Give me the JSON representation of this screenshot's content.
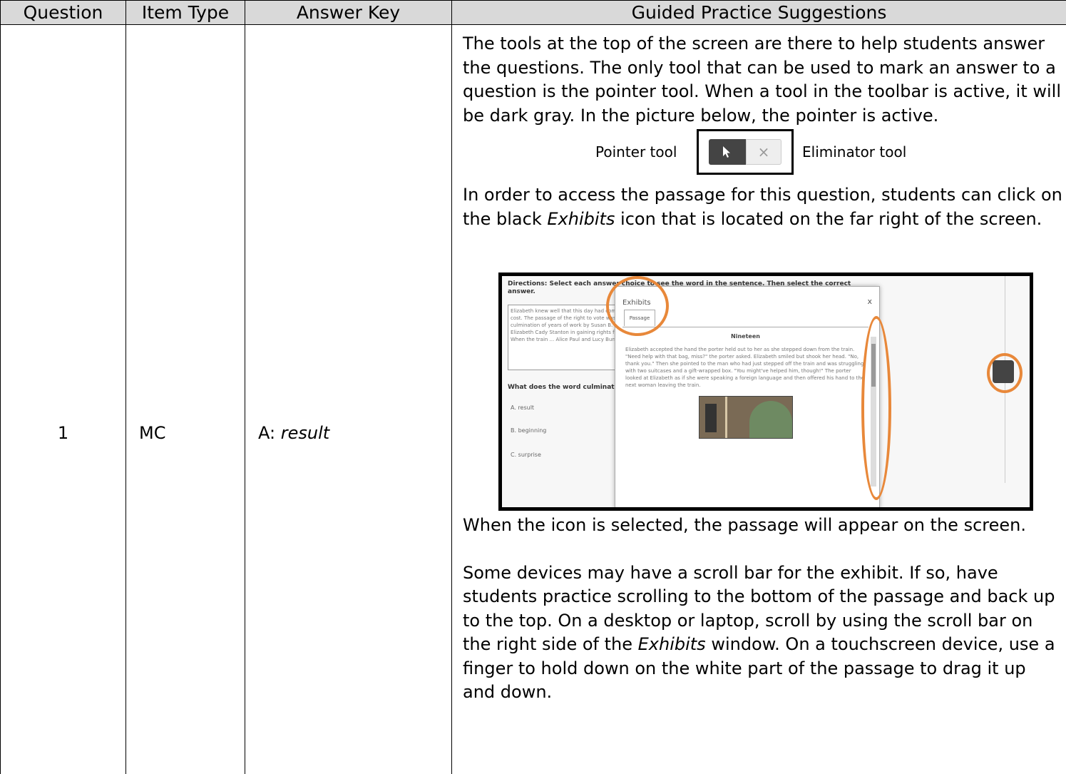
{
  "table": {
    "headers": {
      "question": "Question",
      "item_type": "Item Type",
      "answer_key": "Answer Key",
      "guided": "Guided Practice Suggestions"
    },
    "row": {
      "question": "1",
      "item_type": "MC",
      "answer_key_prefix": "A: ",
      "answer_key_value": "result"
    }
  },
  "guided": {
    "p1": "The tools at the top of the screen are there to help students answer the questions. The only tool that can be used to mark an answer to a question is the pointer tool. When a tool in the toolbar is active, it will be dark gray. In the picture below, the pointer is active.",
    "tool_figure": {
      "pointer_label": "Pointer tool",
      "eliminator_label": "Eliminator tool",
      "eliminator_glyph": "×"
    },
    "p2_a": "In order to access the passage for this question, students can click on the black ",
    "p2_em": "Exhibits",
    "p2_b": " icon that is located on the far right of the screen.",
    "screenshot": {
      "directions": "Directions: Select each answer choice to see the word in the sentence. Then select the correct answer.",
      "passage_text": "Elizabeth knew well that this day had come without a cost. The passage of the right to vote was the culmination of years of work by Susan B. Anthony and Elizabeth Cady Stanton in gaining rights for women. When the train ... Alice Paul and Lucy Burns, who pl...",
      "question": "What does the word culmination mean?",
      "options": [
        "A. result",
        "B. beginning",
        "C. surprise"
      ],
      "modal_title": "Exhibits",
      "modal_close": "x",
      "modal_tab": "Passage",
      "story_title": "Nineteen",
      "story_text": "Elizabeth accepted the hand the porter held out to her as she stepped down from the train. \"Need help with that bag, miss?\" the porter asked. Elizabeth smiled but shook her head. \"No, thank you.\" Then she pointed to the man who had just stepped off the train and was struggling with two suitcases and a gift-wrapped box. \"You might've helped him, though!\" The porter looked at Elizabeth as if she were speaking a foreign language and then offered his hand to the next woman leaving the train."
    },
    "p3": "When the icon is selected, the passage will appear on the screen.",
    "p4_a": "Some devices may have a scroll bar for the exhibit. If so, have students practice scrolling to the bottom of the passage and back up to the top. On a desktop or laptop, scroll by using the scroll bar on the right side of the ",
    "p4_em": "Exhibits",
    "p4_b": " window.  On a touchscreen device, use a finger to hold down on the white part of the passage to drag it up and down."
  },
  "colors": {
    "header_bg": "#d9d9d9",
    "highlight": "#e8883a",
    "active_tool": "#444444"
  }
}
